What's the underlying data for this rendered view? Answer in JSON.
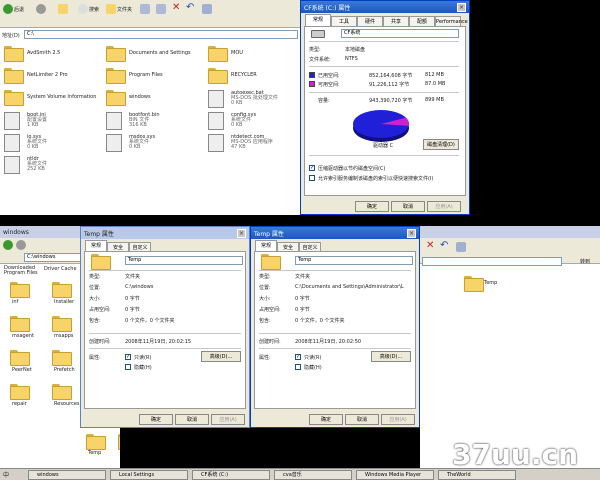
{
  "top_explorer": {
    "toolbar": {
      "back": "后退",
      "search": "搜索",
      "folders": "文件夹"
    },
    "address_label": "地址(D)",
    "address_value": "C:\\",
    "items": [
      {
        "name": "AvdSmith 2.5",
        "sub": ""
      },
      {
        "name": "Documents and Settings",
        "sub": ""
      },
      {
        "name": "MOU",
        "sub": ""
      },
      {
        "name": "NetLimiter 2 Pro",
        "sub": ""
      },
      {
        "name": "Program Files",
        "sub": ""
      },
      {
        "name": "RECYCLER",
        "sub": ""
      },
      {
        "name": "System Volume Information",
        "sub": ""
      },
      {
        "name": "windows",
        "sub": ""
      },
      {
        "name": "autoexec.bat",
        "sub": "MS-DOS 批处理文件\n0 KB"
      },
      {
        "name": "boot.ini",
        "sub": "配置设置\n1 KB"
      },
      {
        "name": "bootfont.bin",
        "sub": "BIN 文件\n316 KB"
      },
      {
        "name": "config.sys",
        "sub": "系统文件\n0 KB"
      },
      {
        "name": "io.sys",
        "sub": "系统文件\n0 KB"
      },
      {
        "name": "msdos.sys",
        "sub": "系统文件\n0 KB"
      },
      {
        "name": "ntdetect.com",
        "sub": "MS-DOS 应用程序\n47 KB"
      },
      {
        "name": "ntldr",
        "sub": "系统文件\n252 KB"
      }
    ]
  },
  "drive_props": {
    "title": "CF系统 (C:) 属性",
    "tabs": [
      "常规",
      "工具",
      "硬件",
      "共享",
      "配额",
      "Performance"
    ],
    "name_value": "CF系统",
    "type_label": "类型:",
    "type_value": "本地磁盘",
    "fs_label": "文件系统:",
    "fs_value": "NTFS",
    "used_label": "已用空间:",
    "used_bytes": "852,164,608 字节",
    "used_mb": "812 MB",
    "free_label": "可用空间:",
    "free_bytes": "91,226,112 字节",
    "free_mb": "87.0 MB",
    "cap_label": "容量:",
    "cap_bytes": "943,390,720 字节",
    "cap_mb": "899 MB",
    "drive_label": "驱动器 C",
    "cleanup": "磁盘清理(D)",
    "compress": "压缩驱动器以节约磁盘空间(C)",
    "index": "允许索引服务编制该磁盘的索引以便快速搜索文件(I)",
    "ok": "确定",
    "cancel": "取消",
    "apply": "应用(A)",
    "colors": {
      "used": "#2020d8",
      "free": "#d020d0"
    },
    "used_fraction": 0.903
  },
  "windows_explorer": {
    "title": "windows",
    "address_value": "C:\\windows",
    "top_items": [
      "Downloaded Program Files",
      "Driver Cache"
    ],
    "items": [
      "inf",
      "Installer",
      "msagent",
      "msapps",
      "PeerNet",
      "Prefetch",
      "repair",
      "Resources"
    ],
    "bottom_items": [
      "Temp",
      "twain_32",
      "Web",
      "WinSxS"
    ]
  },
  "temp_props1": {
    "title": "Temp 属性",
    "tabs": [
      "常规",
      "安全",
      "自定义"
    ],
    "name": "Temp",
    "rows": [
      {
        "label": "类型:",
        "value": "文件夹"
      },
      {
        "label": "位置:",
        "value": "C:\\windows"
      },
      {
        "label": "大小:",
        "value": "0 字节"
      },
      {
        "label": "占用空间:",
        "value": "0 字节"
      },
      {
        "label": "包含:",
        "value": "0 个文件，0 个文件夹"
      }
    ],
    "created_label": "创建时间:",
    "created_value": "2008年11月19日, 20:02:15",
    "attr_label": "属性:",
    "readonly": "只读(R)",
    "hidden": "隐藏(H)",
    "advanced": "高级(D)...",
    "ok": "确定",
    "cancel": "取消",
    "apply": "应用(A)"
  },
  "temp_props2": {
    "title": "Temp 属性",
    "tabs": [
      "常规",
      "安全",
      "自定义"
    ],
    "name": "Temp",
    "rows": [
      {
        "label": "类型:",
        "value": "文件夹"
      },
      {
        "label": "位置:",
        "value": "C:\\Documents and Settings\\Administrator\\L"
      },
      {
        "label": "大小:",
        "value": "0 字节"
      },
      {
        "label": "占用空间:",
        "value": "0 字节"
      },
      {
        "label": "包含:",
        "value": "0 个文件，0 个文件夹"
      }
    ],
    "created_label": "创建时间:",
    "created_value": "2008年11月19日, 20:02:50",
    "attr_label": "属性:",
    "readonly": "只读(R)",
    "hidden": "隐藏(H)",
    "advanced": "高级(D)...",
    "ok": "确定",
    "cancel": "取消",
    "apply": "应用(A)"
  },
  "right_explorer": {
    "go": "转到",
    "folder": "Temp"
  },
  "taskbar": {
    "items": [
      "windows",
      "Local Settings",
      "CF系统 (C:)",
      "cva音乐",
      "Windows Media Player",
      "TheWorld"
    ],
    "ime": "中"
  },
  "watermark": "37uu.cn"
}
